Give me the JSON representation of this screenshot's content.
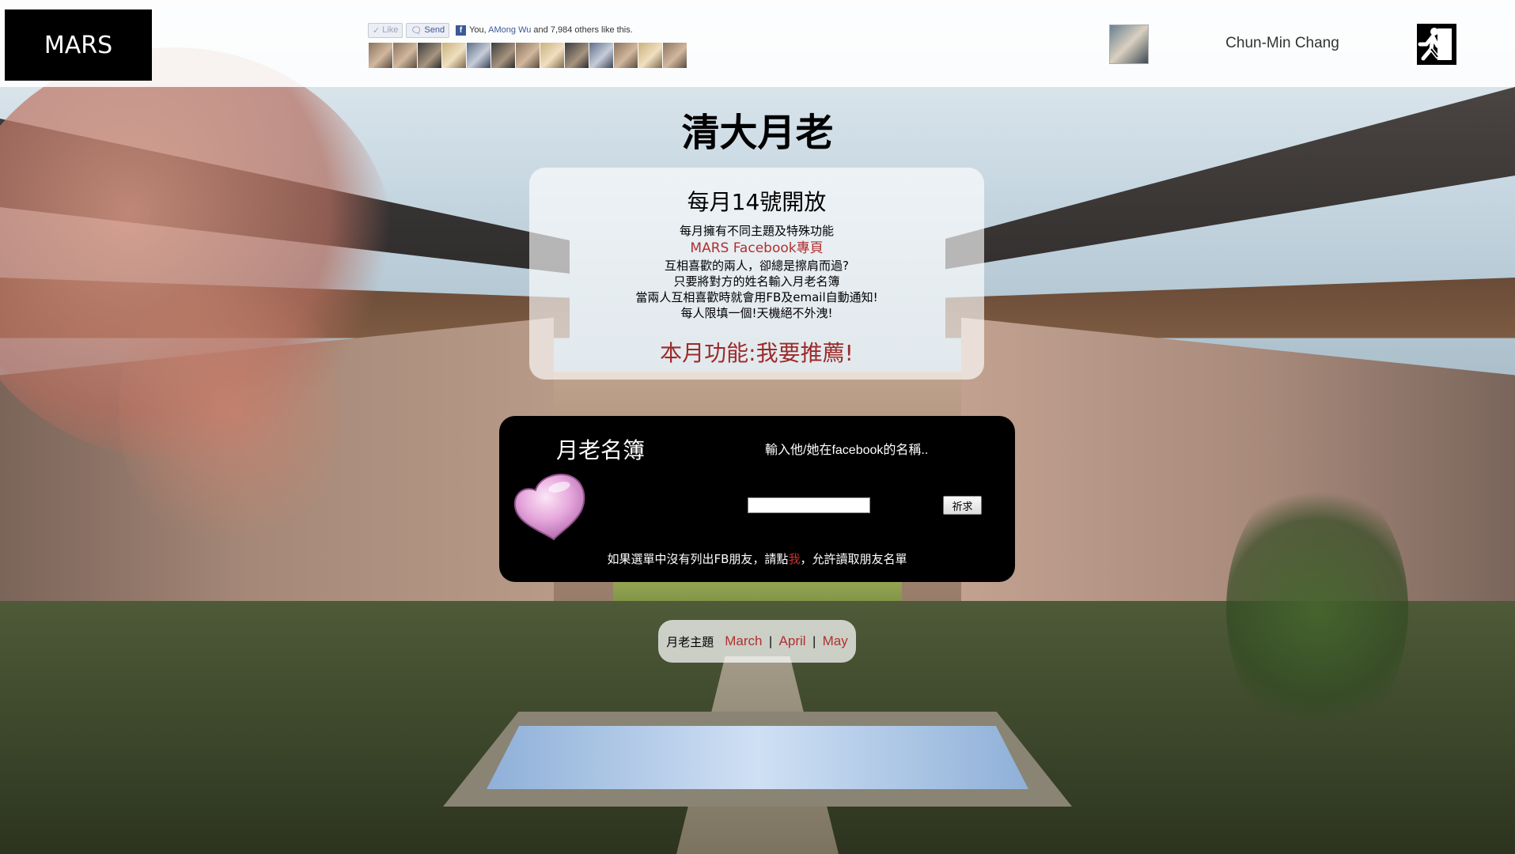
{
  "header": {
    "logo": "MARS",
    "fb": {
      "like_label": "Like",
      "send_label": "Send",
      "text_prefix": "You, ",
      "friend_name": "AMong Wu",
      "text_suffix": " and 7,984 others like this."
    },
    "faces_count": 13,
    "user_name": "Chun-Min Chang",
    "logout_icon": "exit-running-man-icon"
  },
  "title": "清大月老",
  "info": {
    "heading": "每月14號開放",
    "lines": [
      "每月擁有不同主題及特殊功能",
      "MARS Facebook專頁",
      "互相喜歡的兩人，卻總是擦肩而過?",
      "只要將對方的姓名輸入月老名簿",
      "當兩人互相喜歡時就會用FB及email自動通知!",
      "每人限填一個!天機絕不外洩!"
    ],
    "feature": "本月功能:我要推薦!"
  },
  "registry": {
    "title": "月老名簿",
    "hint": "輸入他/她在facebook的名稱..",
    "input_value": "",
    "button": "祈求",
    "note_prefix": "如果選單中沒有列出FB朋友，請點",
    "note_link": "我",
    "note_suffix": "，允許讀取朋友名單"
  },
  "themes": {
    "label": "月老主題",
    "months": [
      "March",
      "April",
      "May"
    ],
    "separator": "|"
  },
  "colors": {
    "accent_red": "#b03030",
    "panel_black": "#000000"
  }
}
